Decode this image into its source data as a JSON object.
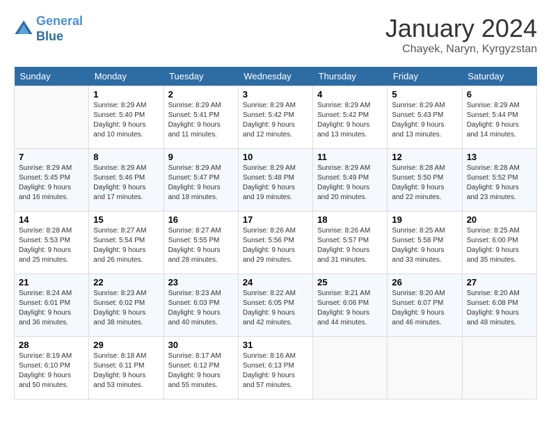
{
  "header": {
    "logo_line1": "General",
    "logo_line2": "Blue",
    "month_year": "January 2024",
    "location": "Chayek, Naryn, Kyrgyzstan"
  },
  "weekdays": [
    "Sunday",
    "Monday",
    "Tuesday",
    "Wednesday",
    "Thursday",
    "Friday",
    "Saturday"
  ],
  "weeks": [
    [
      {
        "day": "",
        "sunrise": "",
        "sunset": "",
        "daylight": ""
      },
      {
        "day": "1",
        "sunrise": "Sunrise: 8:29 AM",
        "sunset": "Sunset: 5:40 PM",
        "daylight": "Daylight: 9 hours and 10 minutes."
      },
      {
        "day": "2",
        "sunrise": "Sunrise: 8:29 AM",
        "sunset": "Sunset: 5:41 PM",
        "daylight": "Daylight: 9 hours and 11 minutes."
      },
      {
        "day": "3",
        "sunrise": "Sunrise: 8:29 AM",
        "sunset": "Sunset: 5:42 PM",
        "daylight": "Daylight: 9 hours and 12 minutes."
      },
      {
        "day": "4",
        "sunrise": "Sunrise: 8:29 AM",
        "sunset": "Sunset: 5:42 PM",
        "daylight": "Daylight: 9 hours and 13 minutes."
      },
      {
        "day": "5",
        "sunrise": "Sunrise: 8:29 AM",
        "sunset": "Sunset: 5:43 PM",
        "daylight": "Daylight: 9 hours and 13 minutes."
      },
      {
        "day": "6",
        "sunrise": "Sunrise: 8:29 AM",
        "sunset": "Sunset: 5:44 PM",
        "daylight": "Daylight: 9 hours and 14 minutes."
      }
    ],
    [
      {
        "day": "7",
        "sunrise": "Sunrise: 8:29 AM",
        "sunset": "Sunset: 5:45 PM",
        "daylight": "Daylight: 9 hours and 16 minutes."
      },
      {
        "day": "8",
        "sunrise": "Sunrise: 8:29 AM",
        "sunset": "Sunset: 5:46 PM",
        "daylight": "Daylight: 9 hours and 17 minutes."
      },
      {
        "day": "9",
        "sunrise": "Sunrise: 8:29 AM",
        "sunset": "Sunset: 5:47 PM",
        "daylight": "Daylight: 9 hours and 18 minutes."
      },
      {
        "day": "10",
        "sunrise": "Sunrise: 8:29 AM",
        "sunset": "Sunset: 5:48 PM",
        "daylight": "Daylight: 9 hours and 19 minutes."
      },
      {
        "day": "11",
        "sunrise": "Sunrise: 8:29 AM",
        "sunset": "Sunset: 5:49 PM",
        "daylight": "Daylight: 9 hours and 20 minutes."
      },
      {
        "day": "12",
        "sunrise": "Sunrise: 8:28 AM",
        "sunset": "Sunset: 5:50 PM",
        "daylight": "Daylight: 9 hours and 22 minutes."
      },
      {
        "day": "13",
        "sunrise": "Sunrise: 8:28 AM",
        "sunset": "Sunset: 5:52 PM",
        "daylight": "Daylight: 9 hours and 23 minutes."
      }
    ],
    [
      {
        "day": "14",
        "sunrise": "Sunrise: 8:28 AM",
        "sunset": "Sunset: 5:53 PM",
        "daylight": "Daylight: 9 hours and 25 minutes."
      },
      {
        "day": "15",
        "sunrise": "Sunrise: 8:27 AM",
        "sunset": "Sunset: 5:54 PM",
        "daylight": "Daylight: 9 hours and 26 minutes."
      },
      {
        "day": "16",
        "sunrise": "Sunrise: 8:27 AM",
        "sunset": "Sunset: 5:55 PM",
        "daylight": "Daylight: 9 hours and 28 minutes."
      },
      {
        "day": "17",
        "sunrise": "Sunrise: 8:26 AM",
        "sunset": "Sunset: 5:56 PM",
        "daylight": "Daylight: 9 hours and 29 minutes."
      },
      {
        "day": "18",
        "sunrise": "Sunrise: 8:26 AM",
        "sunset": "Sunset: 5:57 PM",
        "daylight": "Daylight: 9 hours and 31 minutes."
      },
      {
        "day": "19",
        "sunrise": "Sunrise: 8:25 AM",
        "sunset": "Sunset: 5:58 PM",
        "daylight": "Daylight: 9 hours and 33 minutes."
      },
      {
        "day": "20",
        "sunrise": "Sunrise: 8:25 AM",
        "sunset": "Sunset: 6:00 PM",
        "daylight": "Daylight: 9 hours and 35 minutes."
      }
    ],
    [
      {
        "day": "21",
        "sunrise": "Sunrise: 8:24 AM",
        "sunset": "Sunset: 6:01 PM",
        "daylight": "Daylight: 9 hours and 36 minutes."
      },
      {
        "day": "22",
        "sunrise": "Sunrise: 8:23 AM",
        "sunset": "Sunset: 6:02 PM",
        "daylight": "Daylight: 9 hours and 38 minutes."
      },
      {
        "day": "23",
        "sunrise": "Sunrise: 8:23 AM",
        "sunset": "Sunset: 6:03 PM",
        "daylight": "Daylight: 9 hours and 40 minutes."
      },
      {
        "day": "24",
        "sunrise": "Sunrise: 8:22 AM",
        "sunset": "Sunset: 6:05 PM",
        "daylight": "Daylight: 9 hours and 42 minutes."
      },
      {
        "day": "25",
        "sunrise": "Sunrise: 8:21 AM",
        "sunset": "Sunset: 6:06 PM",
        "daylight": "Daylight: 9 hours and 44 minutes."
      },
      {
        "day": "26",
        "sunrise": "Sunrise: 8:20 AM",
        "sunset": "Sunset: 6:07 PM",
        "daylight": "Daylight: 9 hours and 46 minutes."
      },
      {
        "day": "27",
        "sunrise": "Sunrise: 8:20 AM",
        "sunset": "Sunset: 6:08 PM",
        "daylight": "Daylight: 9 hours and 48 minutes."
      }
    ],
    [
      {
        "day": "28",
        "sunrise": "Sunrise: 8:19 AM",
        "sunset": "Sunset: 6:10 PM",
        "daylight": "Daylight: 9 hours and 50 minutes."
      },
      {
        "day": "29",
        "sunrise": "Sunrise: 8:18 AM",
        "sunset": "Sunset: 6:11 PM",
        "daylight": "Daylight: 9 hours and 53 minutes."
      },
      {
        "day": "30",
        "sunrise": "Sunrise: 8:17 AM",
        "sunset": "Sunset: 6:12 PM",
        "daylight": "Daylight: 9 hours and 55 minutes."
      },
      {
        "day": "31",
        "sunrise": "Sunrise: 8:16 AM",
        "sunset": "Sunset: 6:13 PM",
        "daylight": "Daylight: 9 hours and 57 minutes."
      },
      {
        "day": "",
        "sunrise": "",
        "sunset": "",
        "daylight": ""
      },
      {
        "day": "",
        "sunrise": "",
        "sunset": "",
        "daylight": ""
      },
      {
        "day": "",
        "sunrise": "",
        "sunset": "",
        "daylight": ""
      }
    ]
  ]
}
